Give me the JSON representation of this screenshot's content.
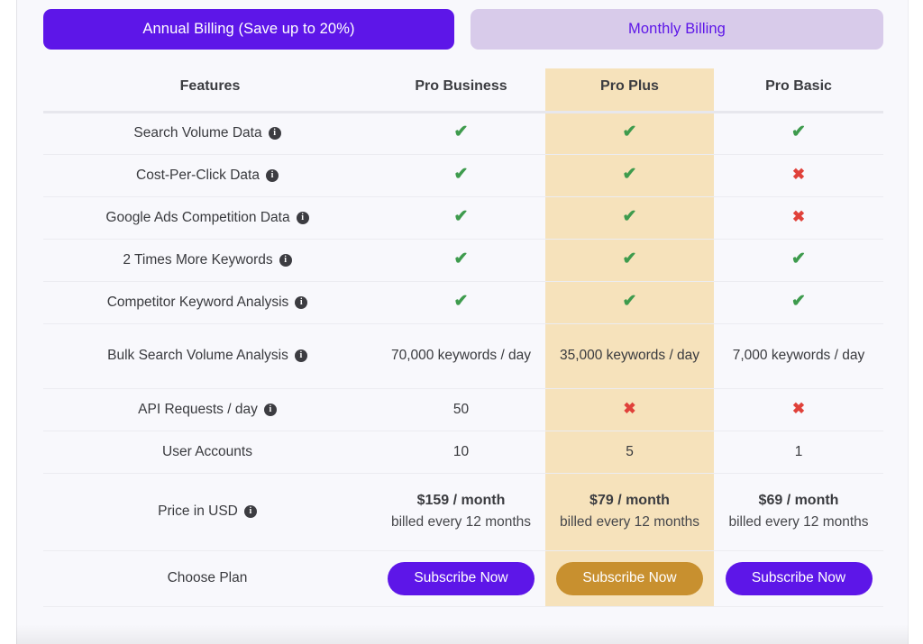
{
  "billing_toggle": {
    "annual_label": "Annual Billing (Save up to 20%)",
    "monthly_label": "Monthly Billing",
    "active": "annual",
    "annual_bg": "#5d16e8",
    "monthly_bg": "#d8cbea",
    "monthly_text_color": "#5d16e8"
  },
  "table": {
    "headers": {
      "features": "Features",
      "pro_business": "Pro Business",
      "pro_plus": "Pro Plus",
      "pro_basic": "Pro Basic"
    },
    "highlight_column": "Pro Plus",
    "highlight_color": "#f6e2bb",
    "icons": {
      "info": "info-icon",
      "yes": "✔",
      "no": "✖",
      "yes_color": "#3e9b4d",
      "no_color": "#e0413a"
    },
    "rows": [
      {
        "feature": "Search Volume Data",
        "has_info": true,
        "pro_business": "✔",
        "pro_plus": "✔",
        "pro_basic": "✔"
      },
      {
        "feature": "Cost-Per-Click Data",
        "has_info": true,
        "pro_business": "✔",
        "pro_plus": "✔",
        "pro_basic": "✖"
      },
      {
        "feature": "Google Ads Competition Data",
        "has_info": true,
        "pro_business": "✔",
        "pro_plus": "✔",
        "pro_basic": "✖"
      },
      {
        "feature": "2 Times More Keywords",
        "has_info": true,
        "pro_business": "✔",
        "pro_plus": "✔",
        "pro_basic": "✔"
      },
      {
        "feature": "Competitor Keyword Analysis",
        "has_info": true,
        "pro_business": "✔",
        "pro_plus": "✔",
        "pro_basic": "✔"
      },
      {
        "feature": "Bulk Search Volume Analysis",
        "has_info": true,
        "pro_business": "70,000 keywords / day",
        "pro_plus": "35,000 keywords / day",
        "pro_basic": "7,000 keywords / day"
      },
      {
        "feature": "API Requests / day",
        "has_info": true,
        "pro_business": "50",
        "pro_plus": "✖",
        "pro_basic": "✖"
      },
      {
        "feature": "User Accounts",
        "has_info": false,
        "pro_business": "10",
        "pro_plus": "5",
        "pro_basic": "1"
      }
    ],
    "price_row": {
      "feature": "Price in USD",
      "has_info": true,
      "pro_business": {
        "amount": "$159 / month",
        "note": "billed every 12 months"
      },
      "pro_plus": {
        "amount": "$79 / month",
        "note": "billed every 12 months"
      },
      "pro_basic": {
        "amount": "$69 / month",
        "note": "billed every 12 months"
      }
    },
    "choose_row": {
      "feature": "Choose Plan",
      "pro_business_button": "Subscribe Now",
      "pro_plus_button": "Subscribe Now",
      "pro_basic_button": "Subscribe Now",
      "button_color": "#5d16e8",
      "highlight_button_color": "#c8902f"
    }
  }
}
